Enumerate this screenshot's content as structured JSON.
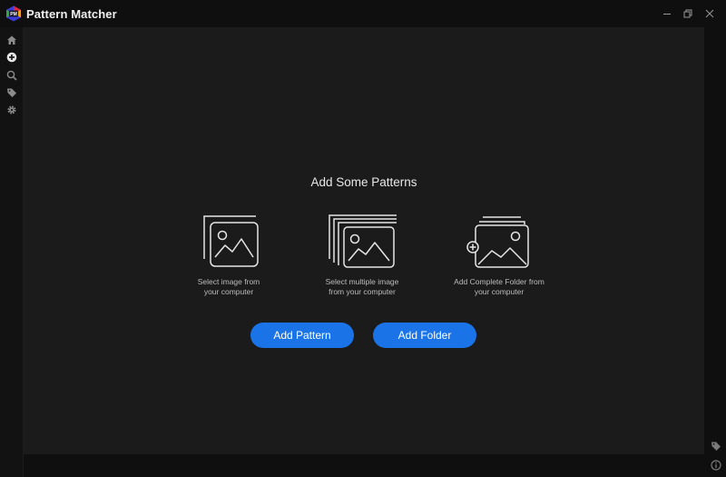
{
  "window": {
    "title": "Pattern Matcher",
    "logo_text": "PM",
    "controls": [
      "minimize-icon",
      "restore-icon",
      "close-icon"
    ]
  },
  "sidebar": {
    "items": [
      {
        "id": "home",
        "icon": "home-icon"
      },
      {
        "id": "add",
        "icon": "plus-circle-icon"
      },
      {
        "id": "search",
        "icon": "search-icon"
      },
      {
        "id": "tags",
        "icon": "tag-icon"
      },
      {
        "id": "settings",
        "icon": "gear-icon"
      }
    ]
  },
  "rightrail": {
    "items": [
      {
        "id": "tag",
        "icon": "tag-icon"
      },
      {
        "id": "info",
        "icon": "info-icon"
      }
    ]
  },
  "main": {
    "headline": "Add Some Patterns",
    "options": [
      {
        "icon": "single-image-icon",
        "caption_line1": "Select image from",
        "caption_line2": "your computer"
      },
      {
        "icon": "multiple-images-icon",
        "caption_line1": "Select multiple image",
        "caption_line2": "from your computer"
      },
      {
        "icon": "folder-images-icon",
        "caption_line1": "Add Complete Folder from",
        "caption_line2": "your computer"
      }
    ],
    "buttons": {
      "add_pattern": "Add Pattern",
      "add_folder": "Add Folder"
    }
  },
  "colors": {
    "background": "#0f0f0f",
    "panel": "#1b1b1b",
    "accent": "#1a74e8",
    "text": "#e8e8e8"
  }
}
